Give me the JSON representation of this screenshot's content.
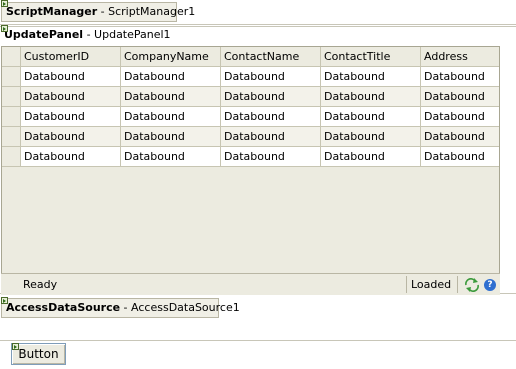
{
  "script_manager": {
    "type": "ScriptManager",
    "sep": " - ",
    "id": "ScriptManager1"
  },
  "update_panel": {
    "type": "UpdatePanel",
    "sep": " - ",
    "id": "UpdatePanel1"
  },
  "grid": {
    "columns": [
      "CustomerID",
      "CompanyName",
      "ContactName",
      "ContactTitle",
      "Address"
    ],
    "rows": [
      [
        "Databound",
        "Databound",
        "Databound",
        "Databound",
        "Databound"
      ],
      [
        "Databound",
        "Databound",
        "Databound",
        "Databound",
        "Databound"
      ],
      [
        "Databound",
        "Databound",
        "Databound",
        "Databound",
        "Databound"
      ],
      [
        "Databound",
        "Databound",
        "Databound",
        "Databound",
        "Databound"
      ],
      [
        "Databound",
        "Databound",
        "Databound",
        "Databound",
        "Databound"
      ]
    ]
  },
  "status_bar": {
    "left_text": "Ready",
    "right_text": "Loaded"
  },
  "access_data_source": {
    "type": "AccessDataSource",
    "sep": " - ",
    "id": "AccessDataSource1"
  },
  "button": {
    "label": "Button"
  },
  "colors": {
    "panel_bg": "#ecebe0",
    "border": "#b9b6a4",
    "help_blue": "#2f6fd0",
    "refresh_green": "#3b9a3b"
  },
  "icons": {
    "refresh": "refresh-icon",
    "help": "help-icon",
    "control_glyph": "control-glyph-icon"
  }
}
